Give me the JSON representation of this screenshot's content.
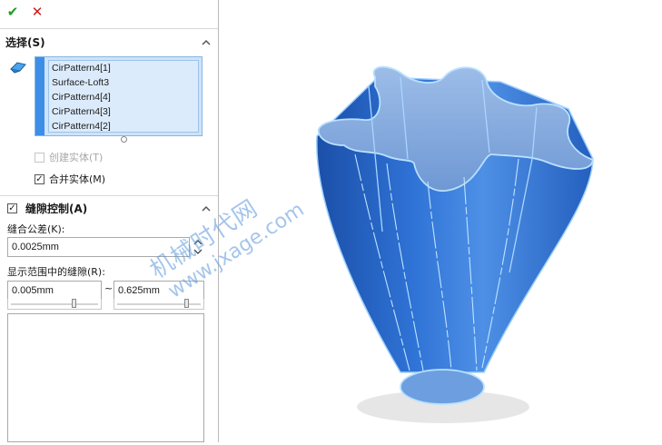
{
  "toolbar": {
    "ok_icon": "checkmark-icon",
    "cancel_icon": "close-icon",
    "ok_glyph": "✔",
    "cancel_glyph": "✕"
  },
  "selection": {
    "title": "选择(S)",
    "items": [
      "CirPattern4[1]",
      "Surface-Loft3",
      "CirPattern4[4]",
      "CirPattern4[3]",
      "CirPattern4[2]"
    ],
    "create_solid_label": "创建实体(T)",
    "create_solid_checked": false,
    "create_solid_enabled": false,
    "merge_entities_label": "合并实体(M)",
    "merge_entities_checked": true
  },
  "gap_control": {
    "title": "缝隙控制(A)",
    "checked": true,
    "tolerance_label": "缝合公差(K):",
    "tolerance_value": "0.0025mm",
    "range_label": "显示范围中的缝隙(R):",
    "range_min": "0.005mm",
    "range_max": "0.625mm",
    "range_separator": "~"
  },
  "watermark": {
    "line1": "机械时代网",
    "line2": "www.jxage.com"
  },
  "colors": {
    "accent": "#3d8ee6",
    "model_fill": "#2f73d6",
    "model_edge": "#9fd0ff",
    "selection_bg": "#cfe3f7"
  }
}
